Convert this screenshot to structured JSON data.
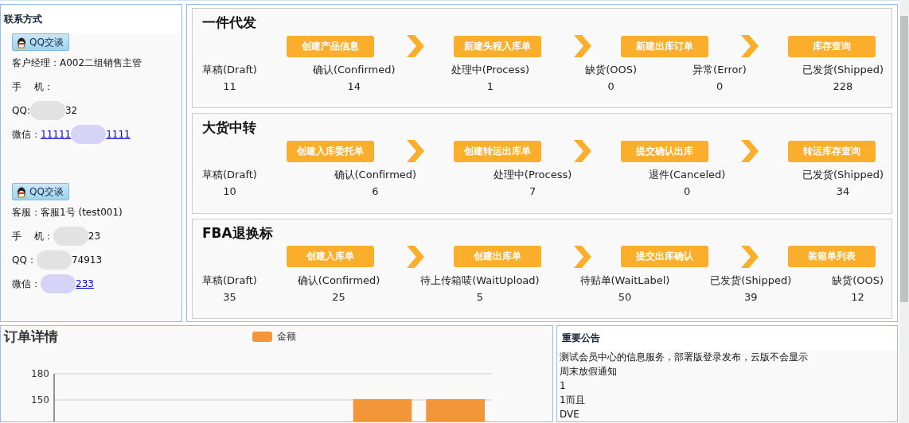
{
  "contact_panel": {
    "title": "联系方式",
    "groups": [
      {
        "chat_button": "QQ交谈",
        "rows": [
          {
            "label": "客户经理：",
            "value": "A002二组销售主管",
            "redacted": false,
            "link": false
          },
          {
            "label": "手　 机：",
            "value": "",
            "redacted": false
          },
          {
            "label": "QQ:",
            "value": "",
            "value_end": "32",
            "redacted": true,
            "link": false
          },
          {
            "label": "微信：",
            "value": "11111",
            "value_end": "1111",
            "redacted": true,
            "link": true
          }
        ]
      },
      {
        "chat_button": "QQ交谈",
        "rows": [
          {
            "label": "客服：",
            "value": "客服1号 (test001)",
            "redacted": false,
            "link": false
          },
          {
            "label": "手　 机：",
            "value": "",
            "value_end": "23",
            "redacted": true,
            "link": false
          },
          {
            "label": "QQ：",
            "value": "",
            "value_end": "74913",
            "redacted": true,
            "link": false
          },
          {
            "label": "微信：",
            "value": "",
            "value_end": "233",
            "redacted": true,
            "link": true
          }
        ]
      }
    ]
  },
  "sections": [
    {
      "title": "一件代发",
      "actions": [
        "创建产品信息",
        "新建头程入库单",
        "新建出库订单",
        "库存查询"
      ],
      "stats": [
        {
          "label": "草稿(Draft)",
          "value": "11"
        },
        {
          "label": "确认(Confirmed)",
          "value": "14"
        },
        {
          "label": "处理中(Process)",
          "value": "1"
        },
        {
          "label": "缺货(OOS)",
          "value": "0"
        },
        {
          "label": "异常(Error)",
          "value": "0"
        },
        {
          "label": "已发货(Shipped)",
          "value": "228"
        }
      ]
    },
    {
      "title": "大货中转",
      "actions": [
        "创建入库委托单",
        "创建转运出库单",
        "提交确认出库",
        "转运库存查询"
      ],
      "stats": [
        {
          "label": "草稿(Draft)",
          "value": "10"
        },
        {
          "label": "确认(Confirmed)",
          "value": "6"
        },
        {
          "label": "处理中(Process)",
          "value": "7"
        },
        {
          "label": "退件(Canceled)",
          "value": "0"
        },
        {
          "label": "已发货(Shipped)",
          "value": "34"
        }
      ]
    },
    {
      "title": "FBA退换标",
      "actions": [
        "创建入库单",
        "创建出库单",
        "提交出库确认",
        "装箱单列表"
      ],
      "stats": [
        {
          "label": "草稿(Draft)",
          "value": "35"
        },
        {
          "label": "确认(Confirmed)",
          "value": "25"
        },
        {
          "label": "待上传箱唛(WaitUpload)",
          "value": "5"
        },
        {
          "label": "待贴单(WaitLabel)",
          "value": "50"
        },
        {
          "label": "已发货(Shipped)",
          "value": "39"
        },
        {
          "label": "缺货(OOS)",
          "value": "12"
        }
      ]
    }
  ],
  "order_details": {
    "title": "订单详情",
    "chart_data": {
      "type": "bar",
      "series": [
        {
          "name": "金额",
          "color": "#f3963a",
          "values": [
            null,
            null,
            null,
            null,
            151,
            151
          ]
        }
      ],
      "ylim": [
        0,
        180
      ],
      "yticks": [
        150,
        180
      ]
    }
  },
  "notice_panel": {
    "title": "重要公告",
    "items": [
      "测试会员中心的信息服务，部署版登录发布，云版不会显示",
      "周末放假通知",
      "1",
      "1而且",
      "DVE"
    ]
  }
}
